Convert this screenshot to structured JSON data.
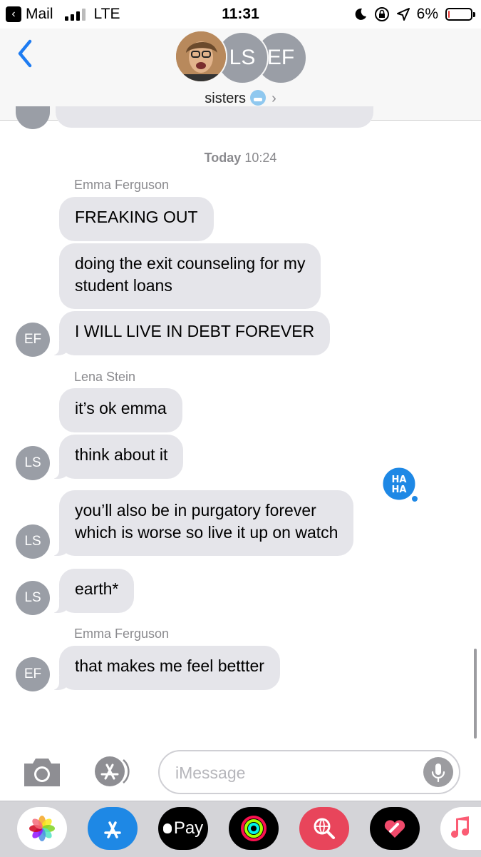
{
  "status_bar": {
    "back_app": "Mail",
    "carrier": "LTE",
    "time": "11:31",
    "battery_percent": "6%",
    "battery_level": 0.06,
    "signal_bars": 3
  },
  "header": {
    "avatar_initials": [
      "LS",
      "EF"
    ],
    "group_name": "sisters",
    "chevron": "›"
  },
  "thread": {
    "timestamp_day": "Today",
    "timestamp_time": "10:24",
    "messages": [
      {
        "sender": "Emma Ferguson",
        "text": "FREAKING OUT"
      },
      {
        "text": "doing the exit counseling for my",
        "text2": "student loans"
      },
      {
        "text": "I WILL LIVE IN DEBT FOREVER",
        "avatar": "EF"
      },
      {
        "sender": "Lena Stein",
        "text": "it’s ok emma"
      },
      {
        "text": "think about it",
        "avatar": "LS"
      },
      {
        "text": "you’ll also be in purgatory forever",
        "text2": "which is worse so live it up on watch",
        "avatar": "LS",
        "reaction": "HA HA"
      },
      {
        "text": "earth*",
        "avatar": "LS"
      },
      {
        "sender": "Emma Ferguson",
        "text": "that makes me feel bettter",
        "avatar": "EF"
      }
    ]
  },
  "input": {
    "placeholder": "iMessage"
  },
  "app_drawer": {
    "apps": [
      "photos",
      "app-store",
      "apple-pay",
      "activity",
      "search-images",
      "digital-touch",
      "music"
    ],
    "pay_label": "Pay"
  },
  "colors": {
    "bubble_gray": "#e5e5ea",
    "avatar_gray": "#9a9ea6",
    "accent_blue": "#1e88e5",
    "battery_red": "#e53935"
  }
}
